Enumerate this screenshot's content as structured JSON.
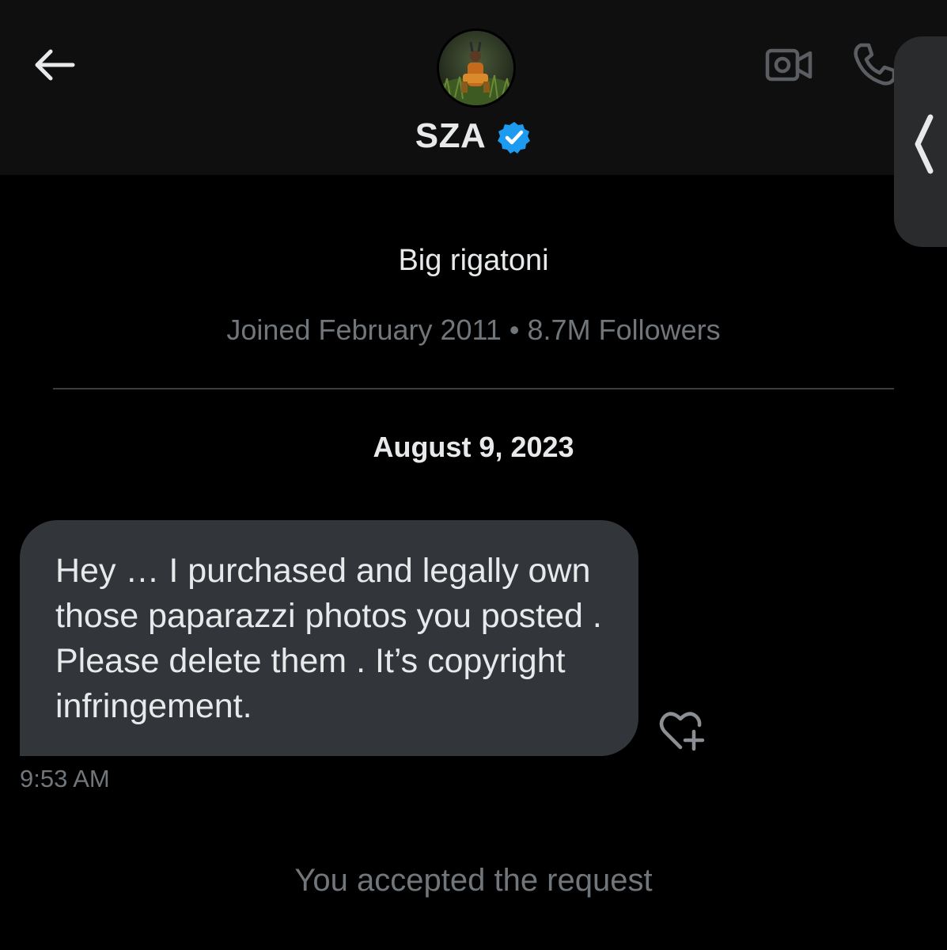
{
  "header": {
    "name": "SZA",
    "verified": true,
    "icons": {
      "back": "back-arrow-icon",
      "video": "video-camera-icon",
      "phone": "phone-icon",
      "verified": "verified-badge-icon",
      "edge": "edge-panel-handle-icon"
    }
  },
  "profile": {
    "bio": "Big rigatoni",
    "meta": "Joined February 2011 • 8.7M Followers"
  },
  "conversation": {
    "date": "August 9, 2023",
    "messages": [
      {
        "text": "Hey … I purchased and legally own those paparazzi photos you posted . Please delete them . It’s copyright infringement.",
        "time": "9:53 AM",
        "reaction_icon": "heart-plus-icon"
      }
    ],
    "status": "You accepted the request"
  },
  "colors": {
    "background": "#000000",
    "header_background": "#0f0f0f",
    "bubble": "#323539",
    "text_primary": "#e7e9ea",
    "text_secondary": "#71767b",
    "verified_blue": "#1d9bf0",
    "edge_panel": "#2a2b2d"
  }
}
